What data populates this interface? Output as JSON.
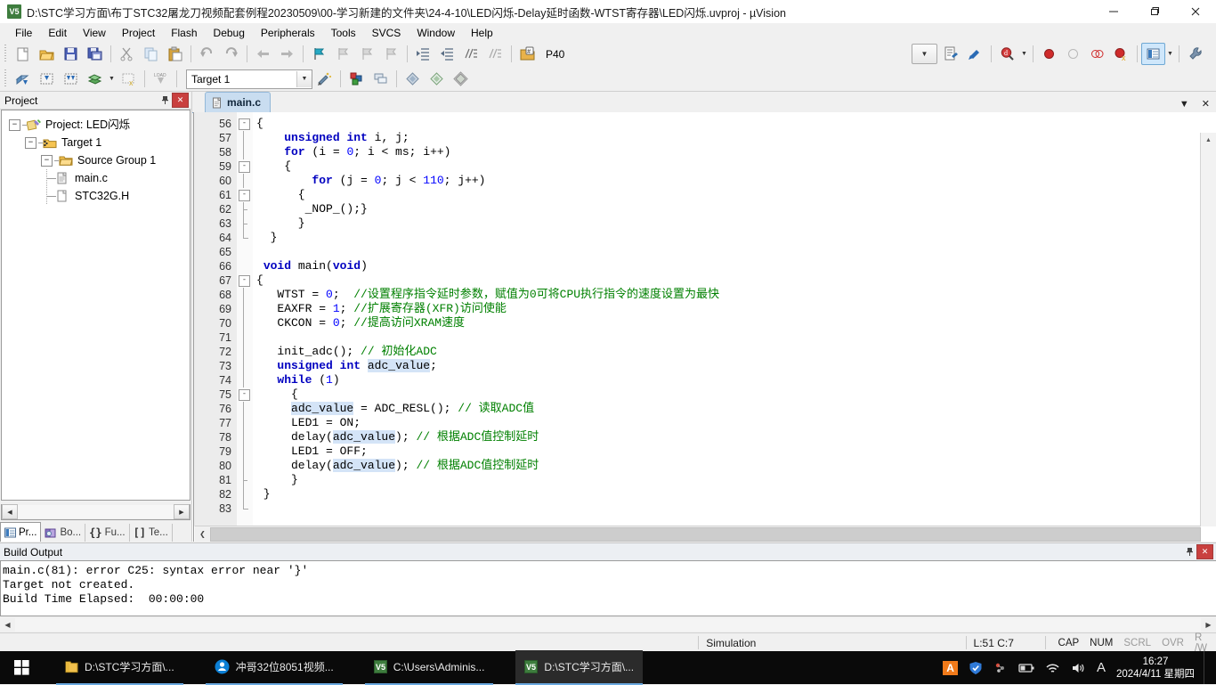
{
  "window": {
    "title": "D:\\STC学习方面\\布丁STC32屠龙刀视频配套例程20230509\\00-学习新建的文件夹\\24-4-10\\LED闪烁-Delay延时函数-WTST寄存器\\LED闪烁.uvproj - µVision",
    "app_icon": "uvision-icon",
    "minimize": "—",
    "maximize": "❐",
    "close": "✕"
  },
  "menu": {
    "items": [
      "File",
      "Edit",
      "View",
      "Project",
      "Flash",
      "Debug",
      "Peripherals",
      "Tools",
      "SVCS",
      "Window",
      "Help"
    ]
  },
  "toolbar2": {
    "target_value": "Target 1",
    "device_label": "P40"
  },
  "project_panel": {
    "title": "Project",
    "pin_icon": "pin-icon",
    "close_icon": "close-icon",
    "tree": [
      {
        "label": "Project: LED闪烁",
        "icon": "project-icon",
        "depth": 0,
        "expander": "-"
      },
      {
        "label": "Target 1",
        "icon": "target-icon",
        "depth": 1,
        "expander": "-"
      },
      {
        "label": "Source Group 1",
        "icon": "folder-icon",
        "depth": 2,
        "expander": "-"
      },
      {
        "label": "main.c",
        "icon": "c-file-icon",
        "depth": 3,
        "expander": ""
      },
      {
        "label": "STC32G.H",
        "icon": "h-file-icon",
        "depth": 3,
        "expander": ""
      }
    ],
    "tabs": [
      {
        "label": "Pr...",
        "icon": "project-tab-icon",
        "active": true
      },
      {
        "label": "Bo...",
        "icon": "books-tab-icon",
        "active": false
      },
      {
        "label": "Fu...",
        "icon": "functions-tab-icon",
        "active": false
      },
      {
        "label": "Te...",
        "icon": "templates-tab-icon",
        "active": false
      }
    ]
  },
  "editor": {
    "tab": {
      "label": "main.c",
      "icon": "c-file-icon"
    },
    "tabbar_buttons": {
      "dropdown": "▼",
      "close": "✕"
    },
    "lines": [
      {
        "n": "56",
        "fold": "-",
        "marker": "none",
        "tokens": [
          {
            "t": "{",
            "c": ""
          }
        ],
        "indent": 0
      },
      {
        "n": "57",
        "fold": "",
        "marker": "line",
        "tokens": [
          {
            "t": "    ",
            "c": ""
          },
          {
            "t": "unsigned",
            "c": "kw"
          },
          {
            "t": " ",
            "c": ""
          },
          {
            "t": "int",
            "c": "kw"
          },
          {
            "t": " i, j;",
            "c": ""
          }
        ],
        "indent": 0
      },
      {
        "n": "58",
        "fold": "",
        "marker": "line",
        "tokens": [
          {
            "t": "    ",
            "c": ""
          },
          {
            "t": "for",
            "c": "kw"
          },
          {
            "t": " (i = ",
            "c": ""
          },
          {
            "t": "0",
            "c": "num"
          },
          {
            "t": "; i < ms; i++)",
            "c": ""
          }
        ],
        "indent": 0
      },
      {
        "n": "59",
        "fold": "-",
        "marker": "line",
        "tokens": [
          {
            "t": "    {",
            "c": ""
          }
        ],
        "indent": 0
      },
      {
        "n": "60",
        "fold": "",
        "marker": "line",
        "tokens": [
          {
            "t": "        ",
            "c": ""
          },
          {
            "t": "for",
            "c": "kw"
          },
          {
            "t": " (j = ",
            "c": ""
          },
          {
            "t": "0",
            "c": "num"
          },
          {
            "t": "; j < ",
            "c": ""
          },
          {
            "t": "110",
            "c": "num"
          },
          {
            "t": "; j++)",
            "c": ""
          }
        ],
        "indent": 0
      },
      {
        "n": "61",
        "fold": "-",
        "marker": "line",
        "tokens": [
          {
            "t": "      {",
            "c": ""
          }
        ],
        "indent": 0
      },
      {
        "n": "62",
        "fold": "",
        "marker": "tick",
        "tokens": [
          {
            "t": "       _NOP_();}",
            "c": ""
          }
        ],
        "indent": 0
      },
      {
        "n": "63",
        "fold": "",
        "marker": "tick",
        "tokens": [
          {
            "t": "      }",
            "c": ""
          }
        ],
        "indent": 0
      },
      {
        "n": "64",
        "fold": "",
        "marker": "lend",
        "tokens": [
          {
            "t": "  }",
            "c": ""
          }
        ],
        "indent": 0
      },
      {
        "n": "65",
        "fold": "",
        "marker": "none",
        "tokens": [
          {
            "t": "",
            "c": ""
          }
        ],
        "indent": 0
      },
      {
        "n": "66",
        "fold": "",
        "marker": "none",
        "tokens": [
          {
            "t": " ",
            "c": ""
          },
          {
            "t": "void",
            "c": "kw"
          },
          {
            "t": " main(",
            "c": ""
          },
          {
            "t": "void",
            "c": "kw"
          },
          {
            "t": ")",
            "c": ""
          }
        ],
        "indent": 0
      },
      {
        "n": "67",
        "fold": "-",
        "marker": "none",
        "tokens": [
          {
            "t": "{",
            "c": ""
          }
        ],
        "indent": 0
      },
      {
        "n": "68",
        "fold": "",
        "marker": "line",
        "tokens": [
          {
            "t": "   WTST = ",
            "c": ""
          },
          {
            "t": "0",
            "c": "num"
          },
          {
            "t": ";  ",
            "c": ""
          },
          {
            "t": "//设置程序指令延时参数，赋值为0可将CPU执行指令的速度设置为最快",
            "c": "cmt"
          }
        ],
        "indent": 0
      },
      {
        "n": "69",
        "fold": "",
        "marker": "line",
        "tokens": [
          {
            "t": "   EAXFR = ",
            "c": ""
          },
          {
            "t": "1",
            "c": "num"
          },
          {
            "t": "; ",
            "c": ""
          },
          {
            "t": "//扩展寄存器(XFR)访问使能",
            "c": "cmt"
          }
        ],
        "indent": 0
      },
      {
        "n": "70",
        "fold": "",
        "marker": "line",
        "tokens": [
          {
            "t": "   CKCON = ",
            "c": ""
          },
          {
            "t": "0",
            "c": "num"
          },
          {
            "t": "; ",
            "c": ""
          },
          {
            "t": "//提高访问XRAM速度",
            "c": "cmt"
          }
        ],
        "indent": 0
      },
      {
        "n": "71",
        "fold": "",
        "marker": "line",
        "tokens": [
          {
            "t": "",
            "c": ""
          }
        ],
        "indent": 0
      },
      {
        "n": "72",
        "fold": "",
        "marker": "line",
        "tokens": [
          {
            "t": "   init_adc(); ",
            "c": ""
          },
          {
            "t": "// 初始化ADC",
            "c": "cmt"
          }
        ],
        "indent": 0
      },
      {
        "n": "73",
        "fold": "",
        "marker": "line",
        "tokens": [
          {
            "t": "   ",
            "c": ""
          },
          {
            "t": "unsigned",
            "c": "kw"
          },
          {
            "t": " ",
            "c": ""
          },
          {
            "t": "int",
            "c": "kw"
          },
          {
            "t": " ",
            "c": ""
          },
          {
            "t": "adc_value",
            "c": "hl"
          },
          {
            "t": ";",
            "c": ""
          }
        ],
        "indent": 0
      },
      {
        "n": "74",
        "fold": "",
        "marker": "line",
        "tokens": [
          {
            "t": "   ",
            "c": ""
          },
          {
            "t": "while",
            "c": "kw"
          },
          {
            "t": " (",
            "c": ""
          },
          {
            "t": "1",
            "c": "num"
          },
          {
            "t": ")",
            "c": ""
          }
        ],
        "indent": 0
      },
      {
        "n": "75",
        "fold": "-",
        "marker": "line",
        "tokens": [
          {
            "t": "     {",
            "c": ""
          }
        ],
        "indent": 0
      },
      {
        "n": "76",
        "fold": "",
        "marker": "line",
        "tokens": [
          {
            "t": "     ",
            "c": ""
          },
          {
            "t": "adc_value",
            "c": "hl"
          },
          {
            "t": " = ADC_RESL(); ",
            "c": ""
          },
          {
            "t": "// 读取ADC值",
            "c": "cmt"
          }
        ],
        "indent": 0
      },
      {
        "n": "77",
        "fold": "",
        "marker": "line",
        "tokens": [
          {
            "t": "     LED1 = ON;",
            "c": ""
          }
        ],
        "indent": 0
      },
      {
        "n": "78",
        "fold": "",
        "marker": "line",
        "tokens": [
          {
            "t": "     delay(",
            "c": ""
          },
          {
            "t": "adc_value",
            "c": "hl"
          },
          {
            "t": "); ",
            "c": ""
          },
          {
            "t": "// 根据ADC值控制延时",
            "c": "cmt"
          }
        ],
        "indent": 0
      },
      {
        "n": "79",
        "fold": "",
        "marker": "line",
        "tokens": [
          {
            "t": "     LED1 = OFF;",
            "c": ""
          }
        ],
        "indent": 0
      },
      {
        "n": "80",
        "fold": "",
        "marker": "line",
        "tokens": [
          {
            "t": "     delay(",
            "c": ""
          },
          {
            "t": "adc_value",
            "c": "hl"
          },
          {
            "t": "); ",
            "c": ""
          },
          {
            "t": "// 根据ADC值控制延时",
            "c": "cmt"
          }
        ],
        "indent": 0
      },
      {
        "n": "81",
        "fold": "",
        "marker": "tick",
        "tokens": [
          {
            "t": "     }",
            "c": ""
          }
        ],
        "indent": 0
      },
      {
        "n": "82",
        "fold": "",
        "marker": "line",
        "tokens": [
          {
            "t": " }",
            "c": ""
          }
        ],
        "indent": 0
      },
      {
        "n": "83",
        "fold": "",
        "marker": "lend",
        "tokens": [
          {
            "t": "",
            "c": ""
          }
        ],
        "indent": 0
      }
    ]
  },
  "build_output": {
    "title": "Build Output",
    "pin_icon": "pin-icon",
    "close_icon": "close-icon",
    "text": "main.c(81): error C25: syntax error near '}'\nTarget not created.\nBuild Time Elapsed:  00:00:00"
  },
  "status_bar": {
    "message": "",
    "simulation": "Simulation",
    "cursor": "L:51 C:7",
    "indicators": [
      {
        "label": "CAP",
        "on": true
      },
      {
        "label": "NUM",
        "on": true
      },
      {
        "label": "SCRL",
        "on": false
      },
      {
        "label": "OVR",
        "on": false
      },
      {
        "label": "R /W",
        "on": false
      }
    ]
  },
  "taskbar": {
    "start_icon": "windows-start-icon",
    "items": [
      {
        "label": "D:\\STC学习方面\\...",
        "icon": "folder-icon",
        "state": "open"
      },
      {
        "label": "冲哥32位8051视频...",
        "icon": "player-icon",
        "state": "open"
      },
      {
        "label": "C:\\Users\\Adminis...",
        "icon": "uvision-icon",
        "state": "open"
      },
      {
        "label": "D:\\STC学习方面\\...",
        "icon": "uvision-icon",
        "state": "active"
      }
    ],
    "tray": [
      {
        "name": "ime-a-icon",
        "glyph": "A"
      },
      {
        "name": "shield-icon",
        "glyph": "🛡"
      },
      {
        "name": "mouse-icon",
        "glyph": "🖱"
      },
      {
        "name": "battery-icon",
        "glyph": "🔋"
      },
      {
        "name": "wifi-icon",
        "glyph": "📶"
      },
      {
        "name": "volume-icon",
        "glyph": "🔊"
      },
      {
        "name": "language-icon",
        "glyph": "A"
      }
    ],
    "clock_time": "16:27",
    "clock_date": "2024/4/11 星期四"
  },
  "colors": {
    "keyword": "#0000c0",
    "number": "#0000ff",
    "comment": "#008000",
    "highlight": "#d4e4f7",
    "accent": "#c9403f",
    "taskbar": "#0a0a0a"
  }
}
